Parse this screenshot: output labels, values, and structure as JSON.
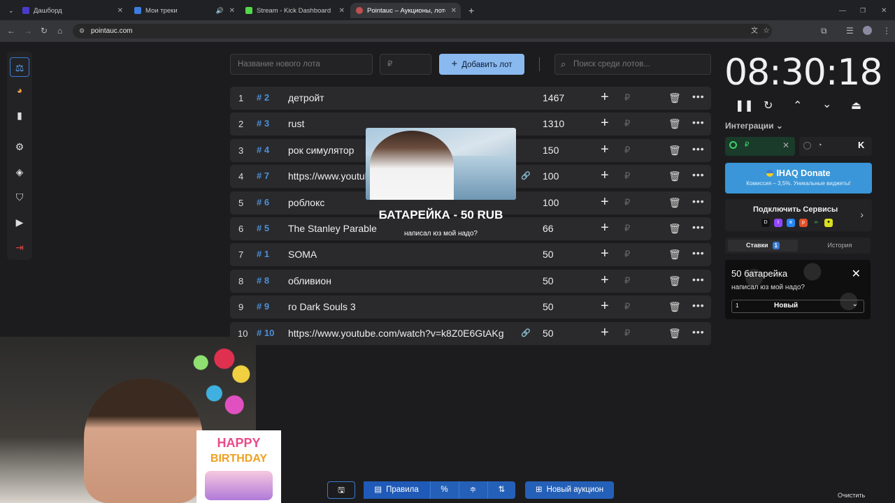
{
  "browser": {
    "tabs": [
      {
        "title": "Дашборд",
        "color": "#4a3cc8"
      },
      {
        "title": "Мои треки",
        "color": "#3b7ce0"
      },
      {
        "title": "Stream - Kick Dashboard",
        "color": "#52d84a"
      },
      {
        "title": "Pointauc – Аукционы, лотере...",
        "color": "#c05050"
      }
    ],
    "new_tab": "+",
    "url": "pointauc.com"
  },
  "sidebar": {
    "items": [
      "gavel-icon",
      "pie-chart-icon",
      "bar-chart-icon",
      "gear-icon",
      "layers-icon",
      "shield-icon",
      "play-icon",
      "logout-icon"
    ]
  },
  "toolbar": {
    "lot_name_placeholder": "Название нового лота",
    "amount_placeholder": "₽",
    "add_label": "Добавить лот",
    "search_placeholder": "Поиск среди лотов..."
  },
  "lots": [
    {
      "num": "1",
      "id": "# 2",
      "name": "детройт",
      "amount": "1467",
      "link": false
    },
    {
      "num": "2",
      "id": "# 3",
      "name": "rust",
      "amount": "1310",
      "link": false
    },
    {
      "num": "3",
      "id": "# 4",
      "name": "рок симулятор",
      "amount": "150",
      "link": false
    },
    {
      "num": "4",
      "id": "# 7",
      "name": "https://www.youtube.com",
      "amount": "100",
      "link": true
    },
    {
      "num": "5",
      "id": "# 6",
      "name": "роблокс",
      "amount": "100",
      "link": false
    },
    {
      "num": "6",
      "id": "# 5",
      "name": "The Stanley Parable",
      "amount": "66",
      "link": false
    },
    {
      "num": "7",
      "id": "# 1",
      "name": "SOMA",
      "amount": "50",
      "link": false
    },
    {
      "num": "8",
      "id": "# 8",
      "name": "обливион",
      "amount": "50",
      "link": false
    },
    {
      "num": "9",
      "id": "# 9",
      "name": "го Dark Souls 3",
      "amount": "50",
      "link": false
    },
    {
      "num": "10",
      "id": "# 10",
      "name": "https://www.youtube.com/watch?v=k8Z0E6GtAKg",
      "amount": "50",
      "link": true
    }
  ],
  "row_actions": {
    "plus": "+",
    "currency": "₽",
    "trash": "🗑",
    "more": "•••"
  },
  "popup": {
    "title": "БАТАРЕЙКА - 50 RUB",
    "message": "написал юз мой надо?"
  },
  "timer": {
    "value": "08:30:18"
  },
  "timer_controls": [
    "pause-icon",
    "reset-icon",
    "chevron-up-icon",
    "chevron-down-icon",
    "eject-icon"
  ],
  "integrations": {
    "title": "Интеграции",
    "ihaq_title": "IHAQ Donate",
    "ihaq_subtitle": "Комиссия – 3,5%. Уникальные виджеты!",
    "connect_title": "Подключить Сервисы"
  },
  "bids_tabs": {
    "bids_label": "Ставки",
    "bids_count": "1",
    "history_label": "История"
  },
  "bid_card": {
    "title": "50 батарейка",
    "message": "написал юз мой надо?",
    "qty": "1",
    "status": "Новый"
  },
  "bottom": {
    "rules_label": "Правила",
    "percent_label": "%",
    "new_auction_label": "Новый аукцион",
    "clear_label": "Очистить"
  },
  "birthday": {
    "line1": "HAPPY",
    "line2": "BIRTHDAY"
  }
}
